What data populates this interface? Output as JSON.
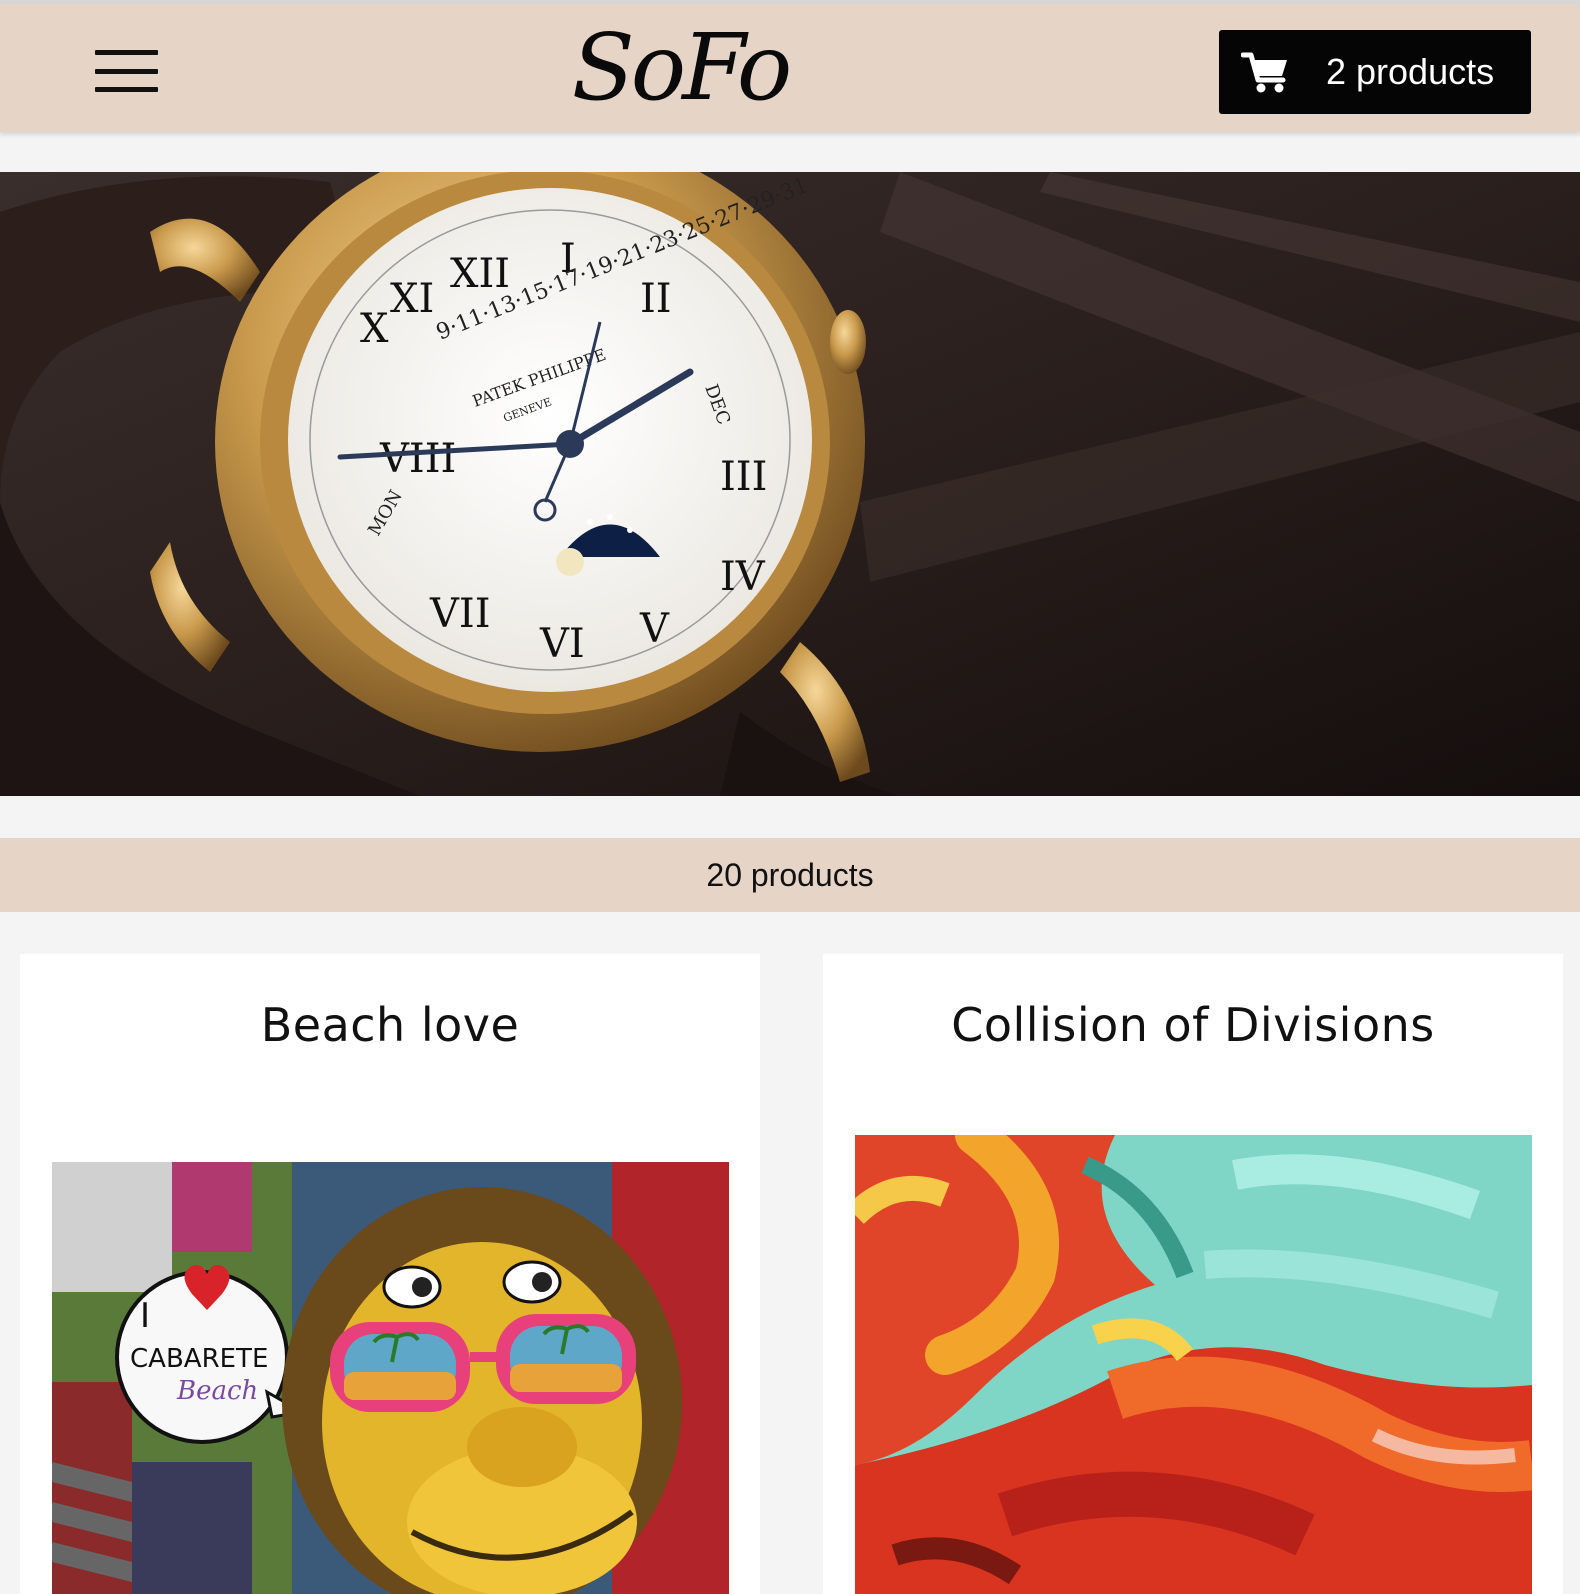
{
  "header": {
    "menu_icon": "hamburger-menu-icon",
    "logo_text": "SoFo",
    "cart": {
      "icon": "shopping-cart-icon",
      "label": "2 products"
    },
    "background": "#e6d4c7"
  },
  "hero": {
    "image": "gold-wristwatch-photo",
    "dial_brand": "PATEK PHILIPPE",
    "dial_city": "GENEVE",
    "dial_month": "DEC",
    "dial_day": "MON"
  },
  "catalog": {
    "count_label": "20 products",
    "products": [
      {
        "title": "Beach love",
        "image": "graffiti-monkey-with-sunglasses",
        "image_text_1": "I",
        "image_text_2": "CABARETE",
        "image_text_3": "Beach"
      },
      {
        "title": "Collision of Divisions",
        "image": "abstract-red-teal-painting"
      }
    ]
  },
  "colors": {
    "accent": "#e6d4c7",
    "cart_bg": "#050505",
    "page_bg": "#f4f4f4"
  }
}
